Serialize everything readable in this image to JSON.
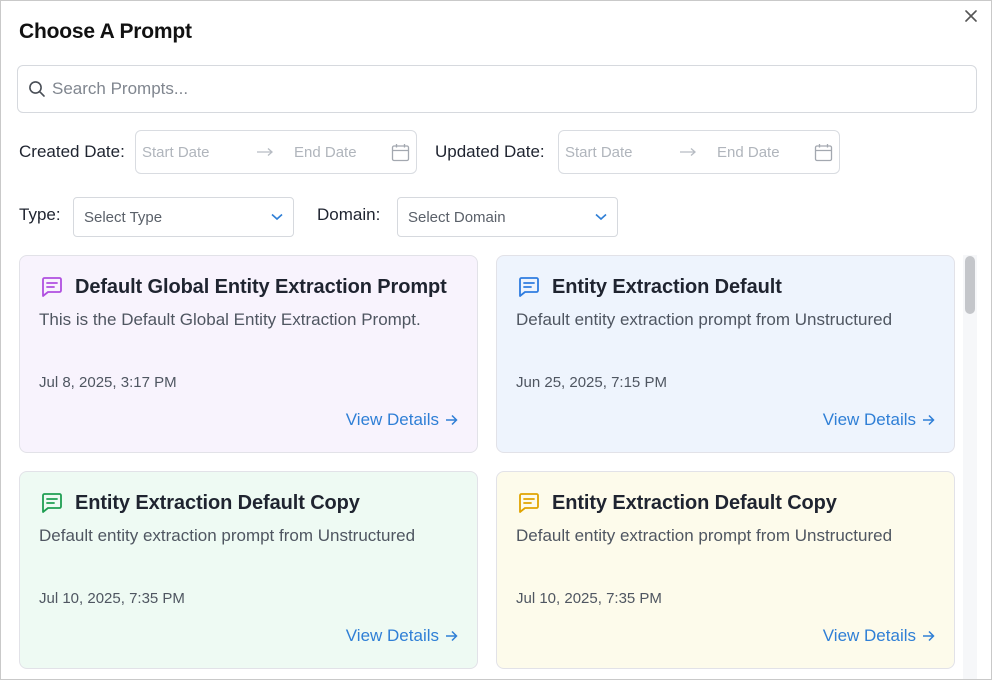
{
  "dialog": {
    "title": "Choose A Prompt"
  },
  "search": {
    "placeholder": "Search Prompts..."
  },
  "filters": {
    "created_label": "Created Date:",
    "updated_label": "Updated Date:",
    "start_placeholder": "Start Date",
    "end_placeholder": "End Date",
    "type_label": "Type:",
    "type_value": "Select Type",
    "domain_label": "Domain:",
    "domain_value": "Select Domain"
  },
  "cards": [
    {
      "title": "Default Global Entity Extraction Prompt",
      "description": "This is the Default Global Entity Extraction Prompt.",
      "date": "Jul 8, 2025, 3:17 PM",
      "link": "View Details",
      "bg": "#f8f3fd",
      "icon_color": "#b04fe0",
      "icon": "message-square-icon"
    },
    {
      "title": "Entity Extraction Default",
      "description": "Default entity extraction prompt from Unstructured",
      "date": "Jun 25, 2025, 7:15 PM",
      "link": "View Details",
      "bg": "#eef4fd",
      "icon_color": "#2e7ce0",
      "icon": "message-square-icon"
    },
    {
      "title": "Entity Extraction Default Copy",
      "description": "Default entity extraction prompt from Unstructured",
      "date": "Jul 10, 2025, 7:35 PM",
      "link": "View Details",
      "bg": "#eefaf3",
      "icon_color": "#1f9e52",
      "icon": "message-square-icon"
    },
    {
      "title": "Entity Extraction Default Copy",
      "description": "Default entity extraction prompt from Unstructured",
      "date": "Jul 10, 2025, 7:35 PM",
      "link": "View Details",
      "bg": "#fdfbeb",
      "icon_color": "#e0a400",
      "icon": "message-square-icon"
    }
  ],
  "colors": {
    "link": "#2f7fd6",
    "border": "#d6d9de"
  }
}
